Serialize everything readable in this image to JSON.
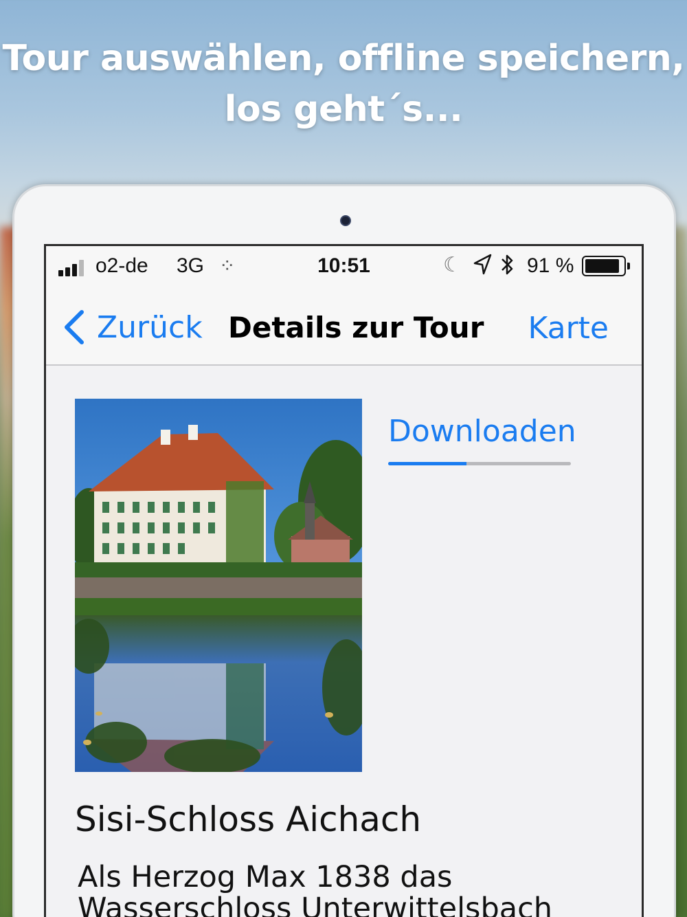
{
  "headline": {
    "line1": "Tour auswählen, offline speichern,",
    "line2": "los geht´s..."
  },
  "status_bar": {
    "carrier": "o2-de",
    "network": "3G",
    "activity_icon": "⁘",
    "time": "10:51",
    "moon_icon": "☾",
    "location_icon": "➤",
    "bluetooth_icon": "ᛒ",
    "battery_percent": "91 %",
    "battery_level": 0.91
  },
  "nav": {
    "back_label": "Zurück",
    "title": "Details zur Tour",
    "right_label": "Karte"
  },
  "download": {
    "label": "Downloaden",
    "progress": 0.43
  },
  "tour": {
    "title": "Sisi-Schloss Aichach",
    "text": "Als Herzog Max 1838 das Wasserschloss Unterwittelsbach"
  },
  "colors": {
    "accent": "#1a7cf0",
    "text": "#111111"
  }
}
